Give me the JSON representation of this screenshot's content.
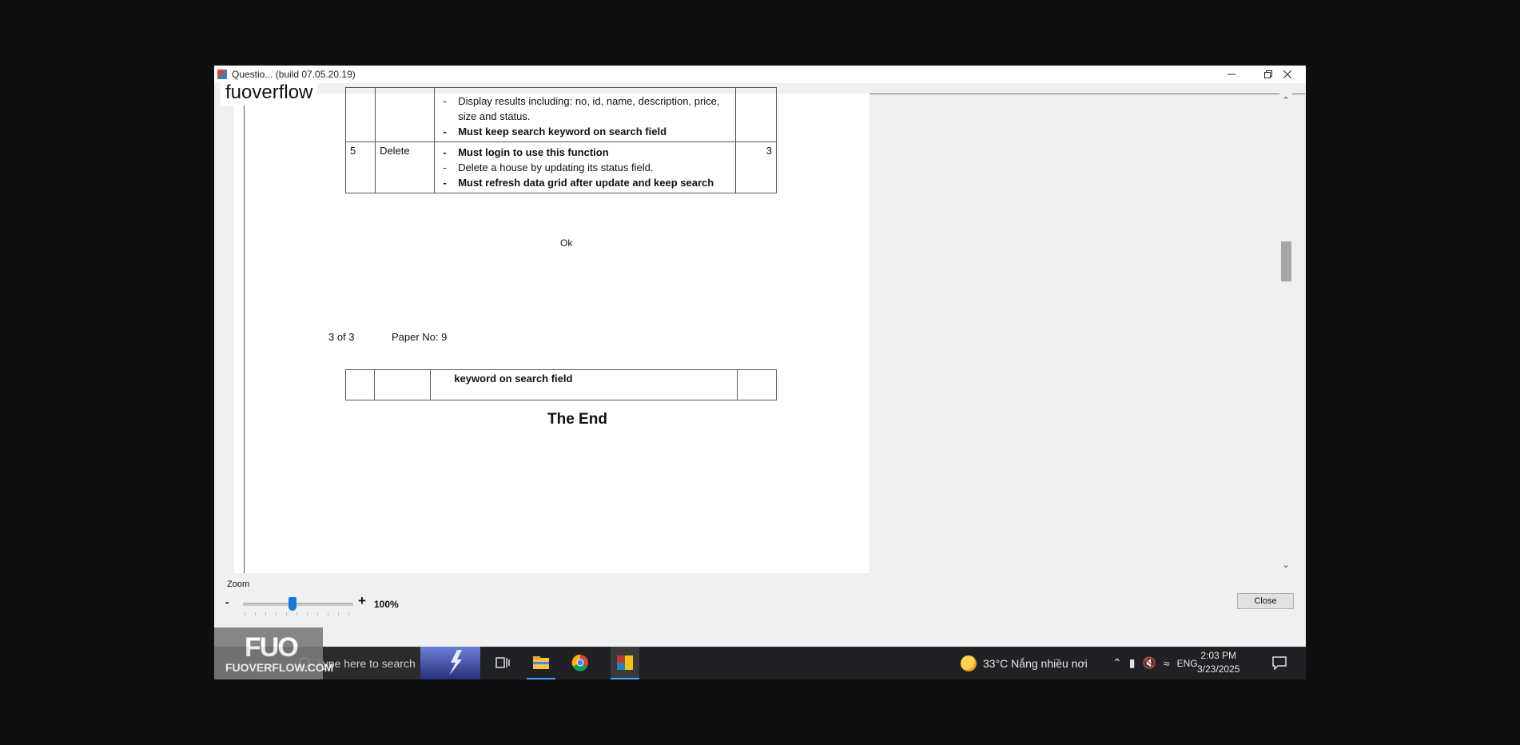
{
  "window": {
    "title": "Questio...                             (build 07.05.20.19)",
    "minimize_icon": "minimize-icon",
    "maximize_icon": "restore-icon",
    "close_icon": "close-icon"
  },
  "brand": "fuoverflow",
  "document": {
    "table_top": {
      "row_prev": {
        "bullets": [
          {
            "text": "Display results including: no, id, name, description, price,",
            "bold": false
          },
          {
            "text": "size and status.",
            "bold": false,
            "continuation": true
          },
          {
            "text": "Must keep search keyword on search field",
            "bold": true
          }
        ]
      },
      "row_delete": {
        "no": "5",
        "name": "Delete",
        "bullets": [
          {
            "text": "Must login to use this function",
            "bold": true
          },
          {
            "text": "Delete a house by updating its status field.",
            "bold": false
          },
          {
            "text": "Must refresh data grid after update and keep search",
            "bold": true
          }
        ],
        "mark": "3"
      }
    },
    "ok_text": "Ok",
    "page_num": "3 of 3",
    "paper_no": "Paper No: 9",
    "table_bottom": {
      "text": "keyword on search field"
    },
    "end_text": "The End"
  },
  "zoom": {
    "label": "Zoom",
    "minus": "-",
    "plus": "+",
    "value": "100%",
    "level_fraction": 0.45
  },
  "close_button": "Close",
  "taskbar": {
    "search_placeholder": "Type here to search",
    "weather": "33°C  Nắng nhiều nơi",
    "language": "ENG",
    "time": "2:03 PM",
    "date": "3/23/2025"
  },
  "watermark": {
    "big": "FUO",
    "small": "FUOVERFLOW.COM"
  }
}
